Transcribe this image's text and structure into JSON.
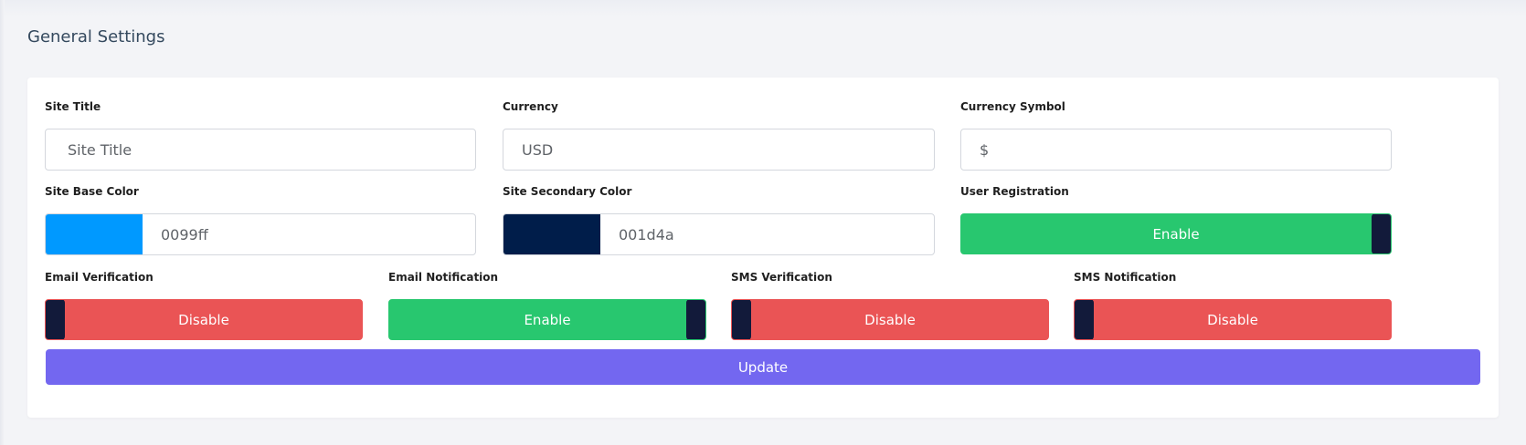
{
  "page": {
    "title": "General Settings"
  },
  "fields": {
    "site_title": {
      "label": "Site Title",
      "placeholder": "Site Title",
      "value": ""
    },
    "currency": {
      "label": "Currency",
      "value": "USD"
    },
    "currency_symbol": {
      "label": "Currency Symbol",
      "value": "$"
    },
    "base_color": {
      "label": "Site Base Color",
      "value": "0099ff",
      "swatch": "#0099ff"
    },
    "secondary_color": {
      "label": "Site Secondary Color",
      "value": "001d4a",
      "swatch": "#001d4a"
    }
  },
  "toggles": {
    "user_registration": {
      "label": "User Registration",
      "state": "Enable",
      "on": true
    },
    "email_verification": {
      "label": "Email Verification",
      "state": "Disable",
      "on": false
    },
    "email_notification": {
      "label": "Email Notification",
      "state": "Enable",
      "on": true
    },
    "sms_verification": {
      "label": "SMS Verification",
      "state": "Disable",
      "on": false
    },
    "sms_notification": {
      "label": "SMS Notification",
      "state": "Disable",
      "on": false
    }
  },
  "actions": {
    "update_label": "Update"
  },
  "colors": {
    "accent": "#7367f0",
    "enabled": "#28c76f",
    "disabled": "#ea5455",
    "knob": "#121a3a"
  }
}
